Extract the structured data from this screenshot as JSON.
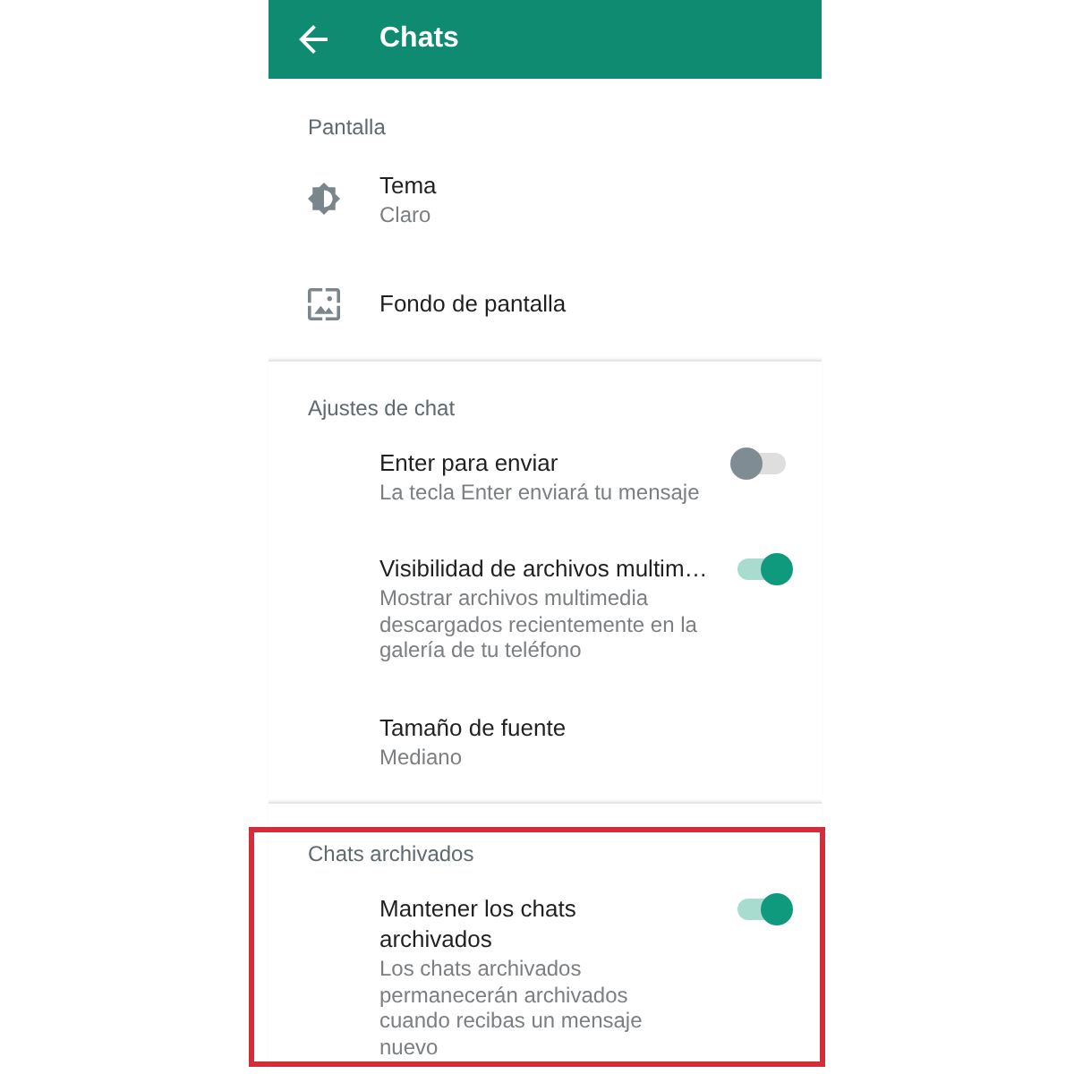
{
  "toolbar": {
    "title": "Chats"
  },
  "sections": [
    {
      "title": "Pantalla",
      "highlighted": false,
      "items": [
        {
          "kind": "theme",
          "title": "Tema",
          "subtitle": "Claro"
        },
        {
          "kind": "wallpaper",
          "title": "Fondo de pantalla"
        }
      ]
    },
    {
      "title": "Ajustes de chat",
      "highlighted": false,
      "items": [
        {
          "kind": "switch",
          "title": "Enter para enviar",
          "subtitle": "La tecla Enter enviará tu mensaje",
          "on": false
        },
        {
          "kind": "switch",
          "title": "Visibilidad de archivos multim…",
          "subtitle": "Mostrar archivos multimedia descargados recientemente en la galería de tu teléfono",
          "on": true
        },
        {
          "kind": "plain",
          "title": "Tamaño de fuente",
          "subtitle": "Mediano"
        }
      ]
    },
    {
      "title": "Chats archivados",
      "highlighted": true,
      "items": [
        {
          "kind": "switch",
          "title": "Mantener los chats\narchivados",
          "subtitle": "Los chats archivados permanecerán archivados cuando recibas un mensaje nuevo",
          "on": true
        }
      ]
    }
  ]
}
